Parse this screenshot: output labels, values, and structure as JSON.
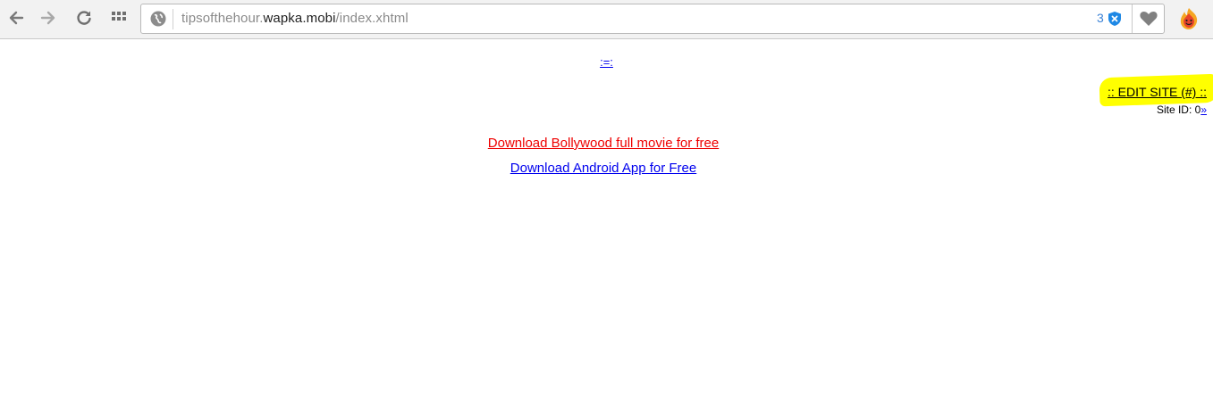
{
  "browser": {
    "url_prefix": "tipsofthehour.",
    "url_host": "wapka.mobi",
    "url_path": "/index.xhtml",
    "extension_badge_count": "3",
    "icons": [
      "back-arrow-icon",
      "forward-arrow-icon",
      "reload-icon",
      "apps-grid-icon",
      "site-info-icon",
      "shield-icon",
      "heart-icon",
      "hola-flame-icon"
    ],
    "colors": {
      "badge": "#3b82d6",
      "highlight": "#ffff00"
    }
  },
  "page": {
    "top_link": ":=:",
    "edit_site": ":: EDIT SITE (#) ::",
    "site_id_label": "Site ID: 0",
    "site_id_link": "»",
    "links": [
      {
        "label": "Download Bollywood full movie for free",
        "color": "#ee0000"
      },
      {
        "label": "Download Android App for Free",
        "color": "#0000ee"
      }
    ]
  }
}
